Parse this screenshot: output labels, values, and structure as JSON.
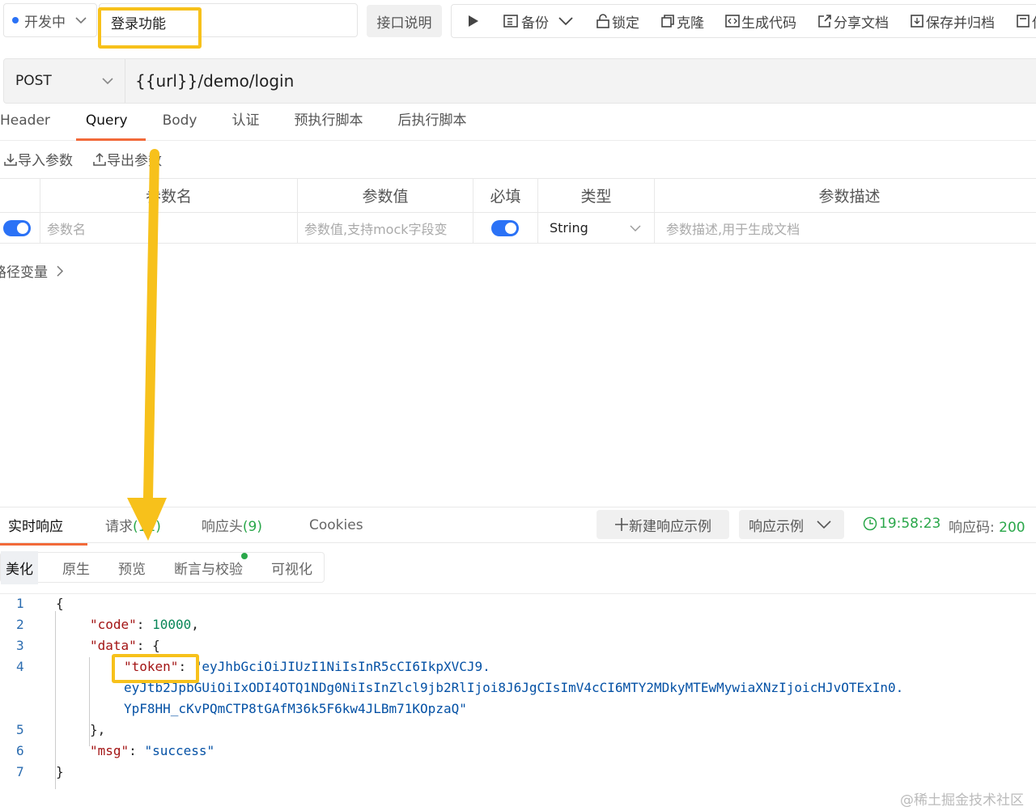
{
  "toolbar": {
    "status": "开发中",
    "name_value": "登录功能",
    "doc_button": "接口说明",
    "actions": [
      "备份",
      "锁定",
      "克隆",
      "生成代码",
      "分享文档",
      "保存并归档",
      "保"
    ]
  },
  "request": {
    "method": "POST",
    "url": "{{url}}/demo/login"
  },
  "tabs": [
    "Header",
    "Query",
    "Body",
    "认证",
    "预执行脚本",
    "后执行脚本"
  ],
  "active_tab": "Query",
  "param_actions": {
    "import": "导入参数",
    "export": "导出参数"
  },
  "param_table": {
    "headers": [
      "参数名",
      "参数值",
      "必填",
      "类型",
      "参数描述"
    ],
    "row": {
      "name_placeholder": "参数名",
      "value_placeholder": "参数值,支持mock字段变",
      "type": "String",
      "desc_placeholder": "参数描述,用于生成文档"
    }
  },
  "path_vars": "路径变量",
  "response": {
    "tabs": [
      {
        "label": "实时响应",
        "count": ""
      },
      {
        "label": "请求",
        "count": "(12)"
      },
      {
        "label": "响应头",
        "count": "(9)"
      },
      {
        "label": "Cookies",
        "count": ""
      }
    ],
    "new_example": "新建响应示例",
    "example_select": "响应示例",
    "time": "19:58:23",
    "code_label": "响应码:",
    "code_value": "200",
    "view_tabs": [
      "美化",
      "原生",
      "预览",
      "断言与校验",
      "可视化"
    ],
    "line_numbers": [
      "1",
      "2",
      "3",
      "4",
      "5",
      "6",
      "7"
    ],
    "json": {
      "open": "{",
      "code_key": "\"code\"",
      "code_val": "10000",
      "data_key": "\"data\"",
      "token_key": "\"token\"",
      "token_line1": "\"eyJhbGciOiJIUzI1NiIsInR5cCI6IkpXVCJ9.",
      "token_line2": "eyJtb2JpbGUiOiIxODI4OTQ1NDg0NiIsInZlcl9jb2RlIjoi8J6JgCIsImV4cCI6MTY2MDkyMTEwMywiaXNzIjoicHJvOTExIn0.",
      "token_line3": "YpF8HH_cKvPQmCTP8tGAfM36k5F6kw4JLBm71KOpzaQ\"",
      "data_close": "},",
      "msg_key": "\"msg\"",
      "msg_val": "\"success\"",
      "close": "}"
    }
  },
  "watermark": "@稀土掘金技术社区",
  "colors": {
    "accent": "#f26a3a",
    "toggle": "#2b72f6",
    "success": "#2aa74a",
    "annotation": "#f7c11b"
  }
}
